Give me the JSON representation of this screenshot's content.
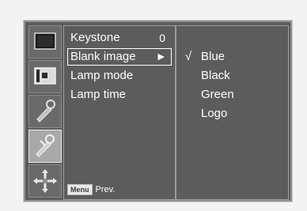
{
  "menu": {
    "items": [
      {
        "label": "Keystone",
        "value": "0"
      },
      {
        "label": "Blank image",
        "arrow": "▶"
      },
      {
        "label": "Lamp mode"
      },
      {
        "label": "Lamp time"
      }
    ],
    "selected_index": 1
  },
  "submenu": {
    "items": [
      {
        "label": "Blue",
        "check": "√"
      },
      {
        "label": "Black",
        "check": ""
      },
      {
        "label": "Green",
        "check": ""
      },
      {
        "label": "Logo",
        "check": ""
      }
    ]
  },
  "footer": {
    "key_label": "Menu",
    "action_label": "Prev."
  },
  "icons": [
    {
      "name": "picture-icon"
    },
    {
      "name": "screen-icon"
    },
    {
      "name": "audio-icon"
    },
    {
      "name": "options-icon",
      "selected": true
    },
    {
      "name": "position-icon"
    }
  ],
  "colors": {
    "panel": "#5c5c5c",
    "selected_tile": "#a9a9a9",
    "text": "#ffffff"
  }
}
